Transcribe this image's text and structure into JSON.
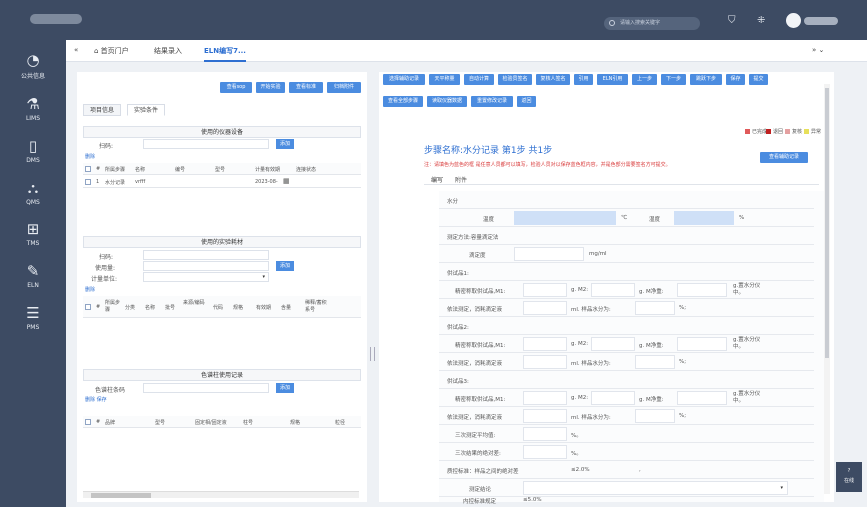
{
  "topbar": {
    "search_placeholder": "请输入搜索关键字",
    "icons": [
      "shirt-icon",
      "grid-icon"
    ]
  },
  "sidebar": {
    "items": [
      {
        "label": "公共信息",
        "icon": "pie-chart-icon",
        "glyph": "◔"
      },
      {
        "label": "LIMS",
        "icon": "flask-icon",
        "glyph": "⚗"
      },
      {
        "label": "DMS",
        "icon": "document-icon",
        "glyph": "▯"
      },
      {
        "label": "QMS",
        "icon": "sitemap-icon",
        "glyph": "⛬"
      },
      {
        "label": "TMS",
        "icon": "apps-icon",
        "glyph": "⊞"
      },
      {
        "label": "ELN",
        "icon": "edit-icon",
        "glyph": "✎"
      },
      {
        "label": "PMS",
        "icon": "list-icon",
        "glyph": "☰"
      }
    ]
  },
  "tabs": {
    "collapse": "«",
    "home": "首页门户",
    "results": "结果录入",
    "current": "ELN编写7...",
    "right_arrows": "»  ⌄"
  },
  "left_panel": {
    "top_buttons": [
      "查看sop",
      "开始实验",
      "查看标准",
      "归档附件"
    ],
    "tabs": [
      "项目信息",
      "实验条件"
    ],
    "equipment": {
      "title": "使用的仪器设备",
      "scan_label": "扫码:",
      "add": "添加",
      "delete": "删除",
      "headers": [
        "#",
        "所属步骤",
        "名称",
        "编号",
        "型号",
        "计量有效期",
        "连接状态"
      ],
      "row": {
        "no": "1",
        "step": "水分记录",
        "name": "vrfff",
        "code": "",
        "model": "",
        "expire": "2023-08-",
        "status": ""
      }
    },
    "materials": {
      "title": "使用的实验耗材",
      "scan_label": "扫码:",
      "qty_label": "使用量:",
      "unit_label": "计量单位:",
      "add": "添加",
      "delete": "删除",
      "headers": [
        "#",
        "所属步骤",
        "分类",
        "名称",
        "批号",
        "来源/编码",
        "代码",
        "规格",
        "有效期",
        "含量",
        "稀释/蓄积系号"
      ]
    },
    "columns": {
      "title": "色谱柱使用记录",
      "code_label": "色谱柱条码",
      "add": "添加",
      "links": "删除 保存",
      "headers": [
        "#",
        "品牌",
        "型号",
        "固定相/固定液",
        "柱号",
        "规格",
        "粒径"
      ]
    }
  },
  "right_panel": {
    "toolbar1": [
      "选择辅助记录",
      "天平称量",
      "自动计算",
      "检验员签名",
      "复核人签名",
      "引用",
      "ELN引用",
      "上一步",
      "下一步",
      "跳跃下步",
      "保存",
      "提交"
    ],
    "toolbar2": [
      "查看全部步骤",
      "读取仪器数据",
      "重置修改记录",
      "返回"
    ],
    "legend": [
      {
        "label": "已完成",
        "color": "#e05a5a"
      },
      {
        "label": "退回",
        "color": "#c02020"
      },
      {
        "label": "复核",
        "color": "#e4a0a0"
      },
      {
        "label": "异常",
        "color": "#e7e05a"
      }
    ],
    "step_title": "步骤名称:水分记录 第1步 共1步",
    "note": "注：请填色为蓝色的框 是任意人员都可以填写，检验人员对以保存蓝色框内容，并是色部分需要签名方可提交。",
    "view_aux": "查看辅助记录",
    "step_tabs": [
      "编写",
      "附件"
    ],
    "form": {
      "section": "水分",
      "temp_label": "温度",
      "temp_unit": "℃",
      "humidity_label": "湿度",
      "humidity_unit": "%",
      "method": "测定方法:容量滴定法",
      "titer_label": "滴定度",
      "titer_unit": "mg/ml",
      "samples": [
        {
          "title": "供试品1:",
          "m1": "精密称取供试品,M1:",
          "m2": "g. M2:",
          "mn": "g. M净重:",
          "pct": "g.置水分仪中。",
          "vol": "依法测定，消耗滴定液",
          "ml": "ml. 样品水分为:",
          "pc": "%;"
        },
        {
          "title": "供试品2:",
          "m1": "精密称取供试品,M1:",
          "m2": "g. M2:",
          "mn": "g. M净重:",
          "pct": "g.置水分仪中。",
          "vol": "依法测定，消耗滴定液",
          "ml": "ml. 样品水分为:",
          "pc": "%;"
        },
        {
          "title": "供试品3:",
          "m1": "精密称取供试品,M1:",
          "m2": "g. M2:",
          "mn": "g. M净重:",
          "pct": "g.置水分仪中。",
          "vol": "依法测定，消耗滴定液",
          "ml": "ml. 样品水分为:",
          "pc": "%;"
        }
      ],
      "avg_label": "三次测定平均值:",
      "avg_unit": "%。",
      "dev_label": "三次结果的绝对差:",
      "dev_unit": "%。",
      "criteria_label": "质控标准：样品之间的绝对差",
      "criteria_value": "≤2.0%",
      "criteria_suffix": ",",
      "conclusion_label": "测定结论",
      "internal_label": "内控标准规定",
      "internal_value": "≤5.0%"
    }
  },
  "fab": {
    "line1": "?",
    "line2": "在线"
  }
}
